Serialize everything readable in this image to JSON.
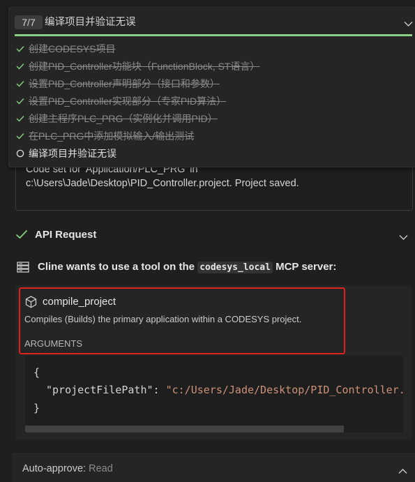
{
  "result": {
    "line1": "Code set for 'Application/PLC_PRG' in",
    "line2": "c:\\Users\\Jade\\Desktop\\PID_Controller.project. Project saved."
  },
  "task_panel": {
    "progress": "7/7",
    "progress_fraction": 1.0,
    "title": "编译项目并验证无误",
    "tasks": [
      {
        "label": "创建CODESYS项目",
        "done": true
      },
      {
        "label": "创建PID_Controller功能块（FunctionBlock, ST语言）",
        "done": true
      },
      {
        "label": "设置PID_Controller声明部分（接口和参数）",
        "done": true
      },
      {
        "label": "设置PID_Controller实现部分（专家PID算法）",
        "done": true
      },
      {
        "label": "创建主程序PLC_PRG（实例化并调用PID）",
        "done": true
      },
      {
        "label": "在PLC_PRG中添加模拟输入/输出测试",
        "done": true
      },
      {
        "label": "编译项目并验证无误",
        "done": false
      }
    ]
  },
  "api_request": {
    "title": "API Request"
  },
  "mcp": {
    "prefix": "Cline wants to use a tool on the",
    "server": "codesys_local",
    "suffix": "MCP server:"
  },
  "tool": {
    "name": "compile_project",
    "description": "Compiles (Builds) the primary application within a CODESYS project.",
    "arguments_label": "ARGUMENTS",
    "code": {
      "open": "{",
      "key": "\"projectFilePath\"",
      "colon": ": ",
      "value": "\"c:/Users/Jade/Desktop/PID_Controller.project\"",
      "close": "}"
    }
  },
  "auto_approve": {
    "label": "Auto-approve:",
    "value": "Read"
  },
  "colors": {
    "success": "#89d185",
    "highlight": "#e0211c",
    "string": "#ce9178"
  }
}
